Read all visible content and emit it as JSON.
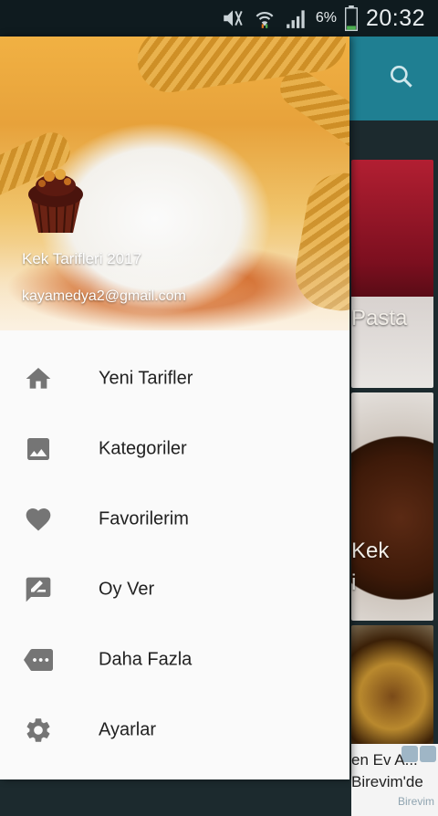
{
  "status_bar": {
    "battery_percent": "6%",
    "time": "20:32",
    "icons": [
      "mute-icon",
      "wifi-icon",
      "signal-icon",
      "battery-icon"
    ]
  },
  "drawer_header": {
    "app_name": "Kek Tarifleri 2017",
    "email": "kayamedya2@gmail.com"
  },
  "menu": [
    {
      "label": "Yeni Tarifler",
      "icon": "home-icon"
    },
    {
      "label": "Kategoriler",
      "icon": "image-icon"
    },
    {
      "label": "Favorilerim",
      "icon": "heart-icon"
    },
    {
      "label": "Oy Ver",
      "icon": "rate-review-icon"
    },
    {
      "label": "Daha Fazla",
      "icon": "more-icon"
    },
    {
      "label": "Ayarlar",
      "icon": "settings-icon"
    }
  ],
  "background": {
    "card1_label": "Pasta",
    "card2_label": "Kek",
    "card2_label2": "i",
    "ad_line1": "en Ev A...",
    "ad_line2": "Birevim'de",
    "ad_brand": "Birevim"
  },
  "colors": {
    "app_bar": "#1f7f92",
    "drawer_bg": "#fafafa",
    "icon_gray": "#757575"
  }
}
